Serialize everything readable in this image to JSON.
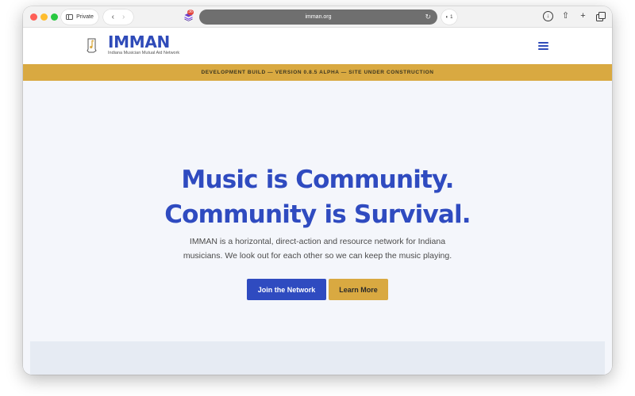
{
  "browser": {
    "private_label": "Private",
    "url": "imman.org",
    "extension_badge": "36",
    "reader_label": "1"
  },
  "site": {
    "brand_name": "IMMAN",
    "brand_subtitle": "Indiana Musician Mutual Aid Network",
    "banner": "DEVELOPMENT BUILD — VERSION 0.8.5 ALPHA — SITE UNDER CONSTRUCTION"
  },
  "hero": {
    "title_line1": "Music is Community.",
    "title_line2": "Community is Survival.",
    "desc_line1": "IMMAN is a horizontal, direct-action and resource network for Indiana",
    "desc_line2": "musicians. We look out for each other so we can keep the music playing.",
    "join_label": "Join the Network",
    "learn_label": "Learn More"
  },
  "colors": {
    "brand_blue": "#2f4bc0",
    "accent_gold": "#d9a941",
    "hero_bg": "#f4f6fb"
  },
  "icons": {
    "sidebar": "sidebar-icon",
    "back": "chevron-left-icon",
    "forward": "chevron-right-icon",
    "extension": "extension-icon",
    "reload": "reload-icon",
    "download": "download-icon",
    "share": "share-icon",
    "new_tab": "plus-icon",
    "tabs": "tabs-overview-icon",
    "menu": "hamburger-menu-icon"
  }
}
